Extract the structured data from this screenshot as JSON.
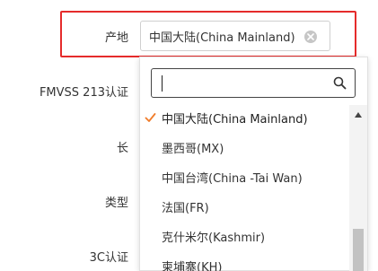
{
  "form": {
    "labels": {
      "origin": "产地",
      "fmvss": "FMVSS 213认证",
      "length": "长",
      "type": "类型",
      "ccc": "3C认证"
    },
    "origin_select": {
      "value": "中国大陆(China Mainland)"
    }
  },
  "dropdown": {
    "search": {
      "value": "",
      "placeholder": ""
    },
    "options": [
      {
        "label": "中国大陆(China Mainland)",
        "selected": true
      },
      {
        "label": "墨西哥(MX)",
        "selected": false
      },
      {
        "label": "中国台湾(China -Tai Wan)",
        "selected": false
      },
      {
        "label": "法国(FR)",
        "selected": false
      },
      {
        "label": "克什米尔(Kashmir)",
        "selected": false
      },
      {
        "label": "柬埔寨(KH)",
        "selected": false
      }
    ]
  },
  "colors": {
    "highlight": "#e52b2b",
    "check": "#f07c2a"
  },
  "icons": {
    "clear": "clear-icon",
    "search": "search-icon",
    "check": "check-icon",
    "scroll_up": "chevron-up-icon"
  }
}
